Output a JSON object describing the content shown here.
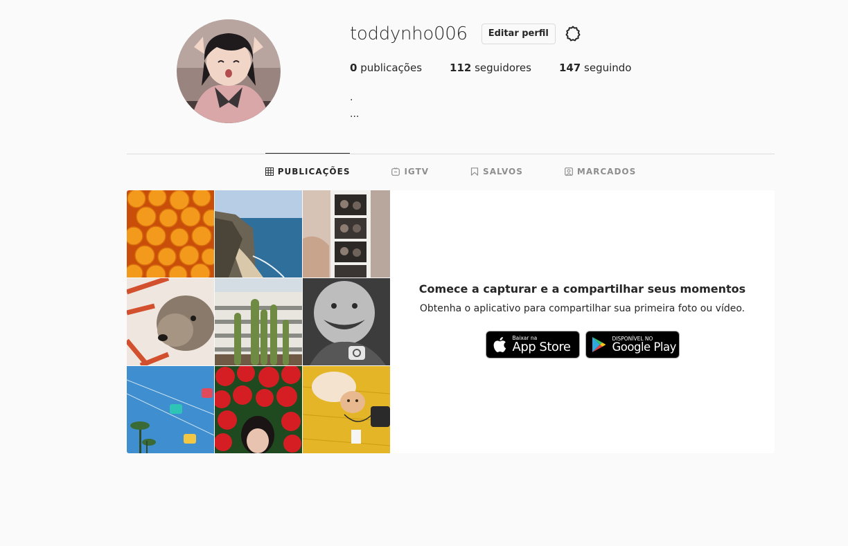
{
  "profile": {
    "username": "toddynho006",
    "edit_label": "Editar perfil",
    "settings_icon": "gear-icon",
    "stats": [
      {
        "count": "0",
        "label": "publicações"
      },
      {
        "count": "112",
        "label": "seguidores"
      },
      {
        "count": "147",
        "label": "seguindo"
      }
    ],
    "bio_lines": [
      ".",
      "..."
    ]
  },
  "tabs": [
    {
      "label": "PUBLICAÇÕES",
      "icon": "grid-icon",
      "active": true
    },
    {
      "label": "IGTV",
      "icon": "igtv-icon",
      "active": false
    },
    {
      "label": "SALVOS",
      "icon": "bookmark-icon",
      "active": false
    },
    {
      "label": "MARCADOS",
      "icon": "tagged-icon",
      "active": false
    }
  ],
  "empty_state": {
    "title": "Comece a capturar e a compartilhar seus momentos",
    "subtitle": "Obtenha o aplicativo para compartilhar sua primeira foto ou vídeo.",
    "app_store": {
      "small": "Baixar na",
      "big": "App Store"
    },
    "google_play": {
      "small": "DISPONÍVEL NO",
      "big": "Google Play"
    }
  },
  "sample_photos": [
    "oranges",
    "coastline",
    "photo-booth-strip",
    "dog",
    "cactus",
    "baby",
    "gondolas",
    "red-flowers",
    "cat-on-yellow"
  ],
  "colors": {
    "text": "#262626",
    "muted": "#8e8e8e",
    "border": "#dbdbdb",
    "background": "#fafafa"
  }
}
